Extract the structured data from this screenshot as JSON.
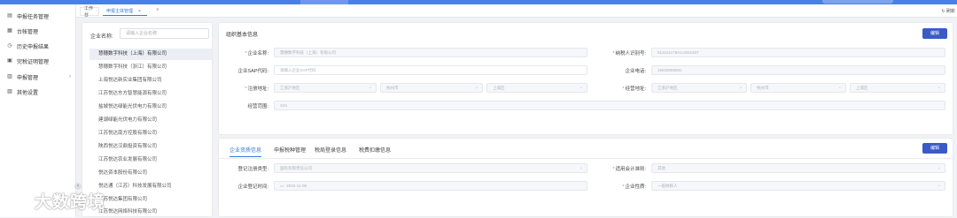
{
  "sidebar": {
    "items": [
      {
        "label": "申报任务管理",
        "icon": "document-icon"
      },
      {
        "label": "台帐管理",
        "icon": "ledger-icon"
      },
      {
        "label": "历史申报结果",
        "icon": "history-icon"
      },
      {
        "label": "完税证明管理",
        "icon": "certificate-icon"
      },
      {
        "label": "申报管理",
        "icon": "declare-icon"
      },
      {
        "label": "其他设置",
        "icon": "settings-icon"
      }
    ]
  },
  "tabs": {
    "home": "工作台",
    "active": "申报主体管理",
    "close": "×",
    "menu": "∨",
    "refresh": "刷新"
  },
  "search": {
    "label": "企业名称:",
    "placeholder": "请输入企业名称"
  },
  "companies": [
    "慧穗数字科技（上海）有限公司",
    "慧穗数字科技（浙江）有限公司",
    "上海悦达新实业集团有限公司",
    "江苏悦达东方智慧能源有限公司",
    "盐城悦达绿能光伏电力有限公司",
    "建湖绿能光伏电力有限公司",
    "江苏悦达南方控股有限公司",
    "陕西悦达汉鼎投资有限公司",
    "江苏悦达农业发展有限公司",
    "悦达资本股份有限公司",
    "悦达通（江苏）科技发展有限公司",
    "江苏悦达集团有限公司",
    "江苏悦达网络科技有限公司"
  ],
  "basic_info": {
    "title": "组织基本信息",
    "edit": "编辑",
    "company_name_label": "企业名称:",
    "company_name_value": "慧穗数字科技（上海）有限公司",
    "tax_id_label": "纳税人识别号:",
    "tax_id_value": "913101178A1U00X29T",
    "sap_label": "企业SAP代码:",
    "sap_placeholder": "请输入企业SAP代码",
    "phone_label": "企业电话:",
    "phone_value": "15618069581",
    "reg_addr_label": "注册地址:",
    "reg_province": "江浙沪地区",
    "reg_city": "杭州市",
    "reg_district": "上城区",
    "biz_addr_label": "经营地址:",
    "biz_province": "江浙沪地区",
    "biz_city": "杭州市",
    "biz_district": "上城区",
    "scope_label": "经营范围:",
    "scope_value": "S34"
  },
  "detail": {
    "tabs": [
      "企业资质信息",
      "申报税种管理",
      "税局登录信息",
      "税费扣缴信息"
    ],
    "edit": "编辑",
    "reg_type_label": "登记注册类型:",
    "reg_type_value": "国有有限责任公司",
    "accounting_label": "适用会计准则:",
    "accounting_value": "其他",
    "reg_time_label": "企业登记时间:",
    "reg_time_value": "2023-11-08",
    "nature_label": "企业性质:",
    "nature_value": "一般纳税人"
  },
  "watermark": {
    "text": "大数跨境"
  }
}
